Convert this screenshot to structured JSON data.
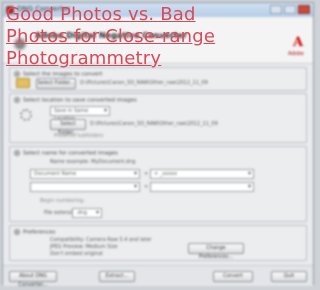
{
  "window": {
    "title": "DNG Converter"
  },
  "header": {
    "title": "Adobe Digital Negative Converter",
    "brand_word": "Adobe",
    "logo_letter": "A"
  },
  "section1": {
    "label": "Select the images to convert",
    "button": "Select Folder...",
    "path": "D:\\Pictures\\Canon_5D_RAW\\Other_raw\\2012_11_09",
    "checkbox_label": "Include images contained within subfolders"
  },
  "section2": {
    "label": "Select location to save converted images",
    "select_value": "Save in Same Location",
    "button": "Select Folder...",
    "path": "D:\\Pictures\\Canon_5D_RAW\\Other_raw\\2012_11_09",
    "sub_label": "Preserve subfolders"
  },
  "section3": {
    "label": "Select name for converted images",
    "name_example": "Name example: MyDocument.dng",
    "select1": "Document Name",
    "plus1": "+",
    "select2": "+ _xxxxx",
    "select3": "",
    "plus2": "+",
    "begin_numbering": "Begin numbering:",
    "file_extension_label": "File extension:",
    "file_extension_value": ".dng"
  },
  "section4": {
    "label": "Preferences",
    "line1": "Compatibility: Camera Raw 5.4 and later",
    "line2": "JPEG Preview: Medium Size",
    "line3": "Don't embed original",
    "button": "Change Preferences..."
  },
  "footer": {
    "about": "About DNG Converter...",
    "extract": "Extract...",
    "convert": "Convert",
    "quit": "Quit"
  },
  "overlay": {
    "link_text": "Good Photos vs. Bad Photos for Close-range Photogrammetry"
  }
}
